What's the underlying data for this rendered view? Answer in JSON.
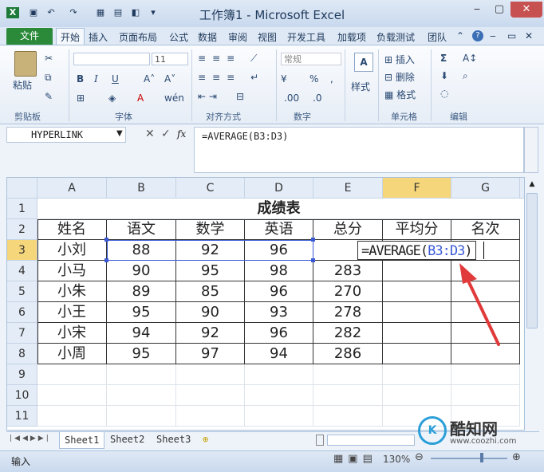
{
  "window": {
    "title": "工作簿1 - Microsoft Excel"
  },
  "ribbon": {
    "file_tab": "文件",
    "tabs": [
      "开始",
      "插入",
      "页面布局",
      "公式",
      "数据",
      "审阅",
      "视图",
      "开发工具",
      "加载项",
      "负载测试",
      "团队"
    ],
    "font_size": "11",
    "number_format": "常规",
    "paste_label": "粘贴",
    "style_label": "样式",
    "insert_label": "插入",
    "delete_label": "删除",
    "format_label": "格式",
    "groups": [
      "剪贴板",
      "字体",
      "对齐方式",
      "数字",
      "单元格",
      "编辑"
    ]
  },
  "formula_bar": {
    "name_box": "HYPERLINK",
    "formula": "=AVERAGE(B3:D3)"
  },
  "grid": {
    "columns": [
      "A",
      "B",
      "C",
      "D",
      "E",
      "F",
      "G"
    ],
    "rows": [
      "1",
      "2",
      "3",
      "4",
      "5",
      "6",
      "7",
      "8",
      "9",
      "10",
      "11"
    ],
    "title": "成绩表",
    "headers": [
      "姓名",
      "语文",
      "数学",
      "英语",
      "总分",
      "平均分",
      "名次"
    ],
    "data": [
      [
        "小刘",
        "88",
        "92",
        "96",
        ""
      ],
      [
        "小马",
        "90",
        "95",
        "98",
        "283"
      ],
      [
        "小朱",
        "89",
        "85",
        "96",
        "270"
      ],
      [
        "小王",
        "95",
        "90",
        "93",
        "278"
      ],
      [
        "小宋",
        "94",
        "92",
        "96",
        "282"
      ],
      [
        "小周",
        "95",
        "97",
        "94",
        "286"
      ]
    ],
    "editing_text": "=AVERAGE(B3:D3)"
  },
  "sheets": [
    "Sheet1",
    "Sheet2",
    "Sheet3"
  ],
  "status": {
    "mode": "输入",
    "zoom": "130%"
  },
  "watermark": {
    "brand": "酷知网",
    "url": "www.coozhi.com"
  },
  "colors": {
    "file_tab": "#2a8a3a",
    "selection": "#3b5bd6",
    "arrow": "#e03a3a"
  }
}
